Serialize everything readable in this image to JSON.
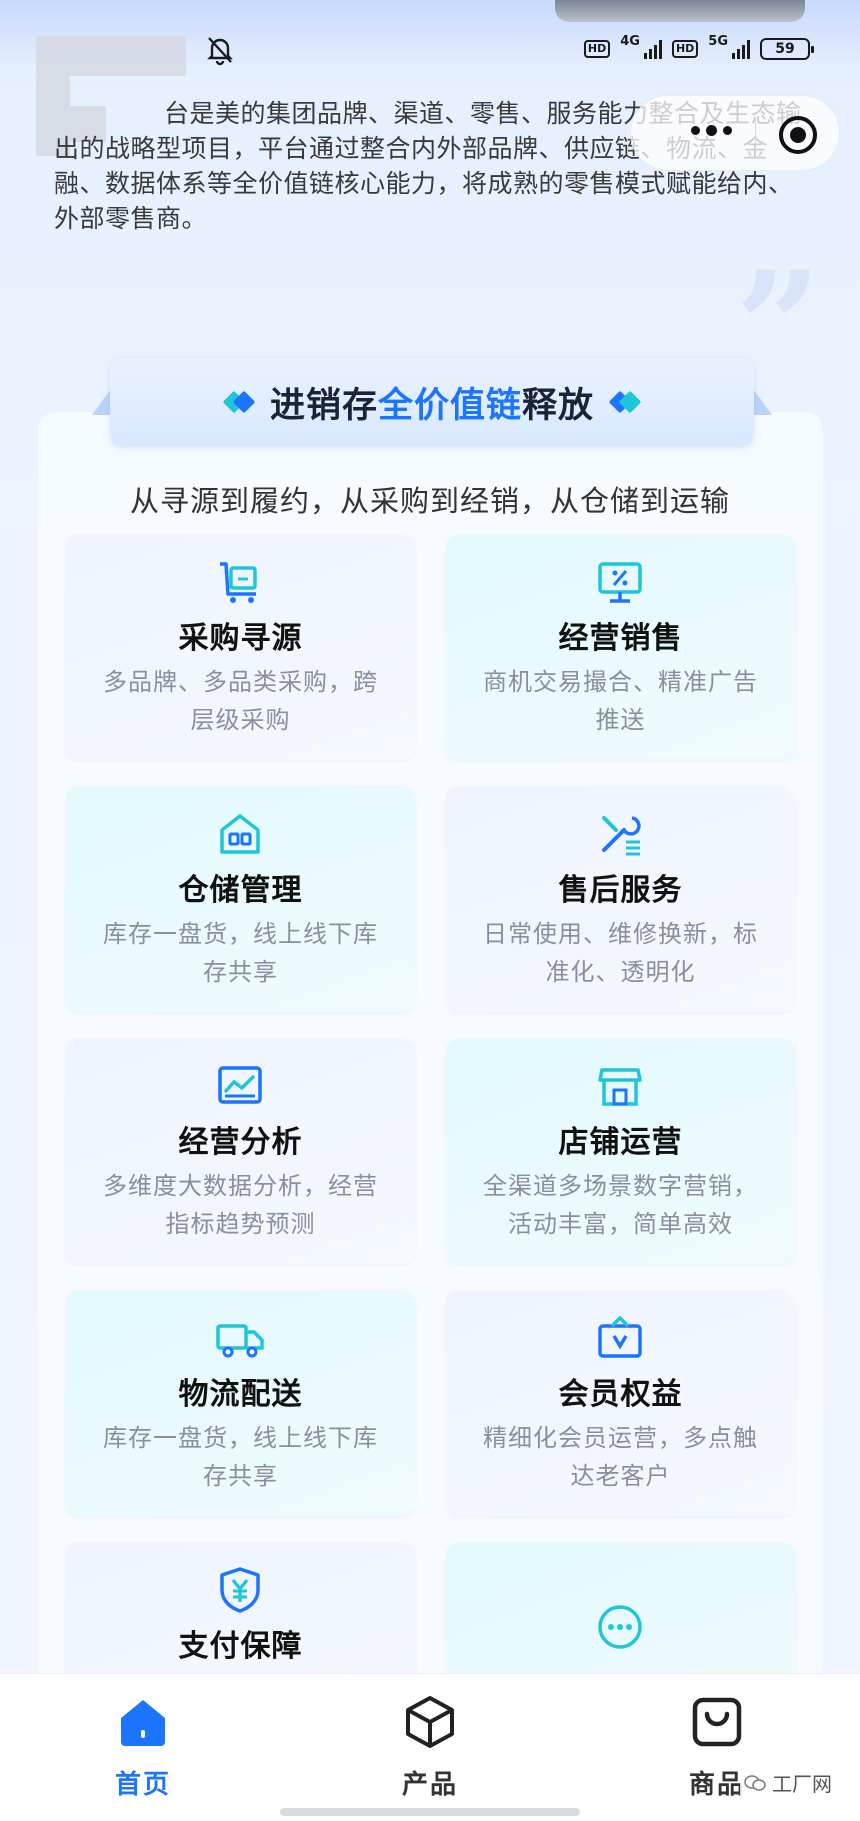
{
  "status_bar": {
    "hd1": "HD",
    "net1": "4G",
    "hd2": "HD",
    "net2": "5G",
    "battery": "59"
  },
  "intro_text": "台是美的集团品牌、渠道、零售、服务能力整合及生态输出的战略型项目，平台通过整合内外部品牌、供应链、物流、金融、数据体系等全价值链核心能力，将成熟的零售模式赋能给内、外部零售商。",
  "banner": {
    "title_prefix": "进销存",
    "title_highlight": "全价值链",
    "title_suffix": "释放"
  },
  "subtitle": "从寻源到履约，从采购到经销，从仓储到运输",
  "cards": [
    {
      "title": "采购寻源",
      "desc": "多品牌、多品类采购，跨层级采购",
      "icon": "shopping-cart-icon"
    },
    {
      "title": "经营销售",
      "desc": "商机交易撮合、精准广告推送",
      "icon": "percent-display-icon"
    },
    {
      "title": "仓储管理",
      "desc": "库存一盘货，线上线下库存共享",
      "icon": "warehouse-icon"
    },
    {
      "title": "售后服务",
      "desc": "日常使用、维修换新，标准化、透明化",
      "icon": "tools-icon"
    },
    {
      "title": "经营分析",
      "desc": "多维度大数据分析，经营指标趋势预测",
      "icon": "chart-board-icon"
    },
    {
      "title": "店铺运营",
      "desc": "全渠道多场景数字营销，活动丰富，简单高效",
      "icon": "store-icon"
    },
    {
      "title": "物流配送",
      "desc": "库存一盘货，线上线下库存共享",
      "icon": "truck-icon"
    },
    {
      "title": "会员权益",
      "desc": "精细化会员运营，多点触达老客户",
      "icon": "vip-bag-icon"
    },
    {
      "title": "支付保障",
      "desc": "",
      "icon": "yuan-shield-icon"
    },
    {
      "title": "",
      "desc": "",
      "icon": "more-dots-icon"
    }
  ],
  "bottom_nav": [
    {
      "label": "首页",
      "icon": "home-icon",
      "active": true
    },
    {
      "label": "产品",
      "icon": "cube-icon",
      "active": false
    },
    {
      "label": "商品",
      "icon": "shopping-bag-icon",
      "active": false
    }
  ],
  "watermark": "工厂网",
  "colors": {
    "accent_blue": "#1d74ff",
    "teal": "#1ec6d8",
    "nav_inactive": "#222222"
  }
}
